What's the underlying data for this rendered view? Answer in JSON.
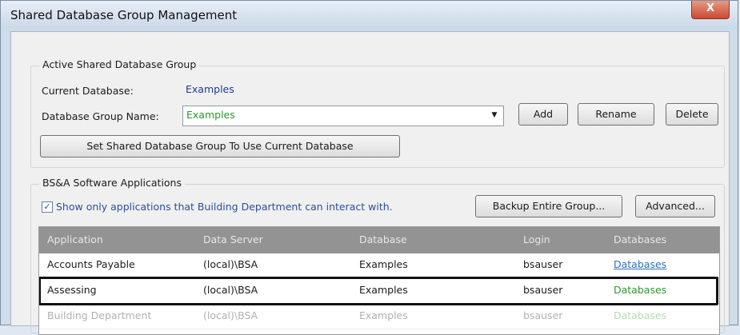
{
  "window": {
    "title": "Shared Database Group Management",
    "close_glyph": "X"
  },
  "active_group": {
    "heading": "Active Shared Database Group",
    "current_database_label": "Current Database:",
    "current_database_value": "Examples",
    "group_name_label": "Database Group Name:",
    "group_name_value": "Examples",
    "add_label": "Add",
    "rename_label": "Rename",
    "delete_label": "Delete",
    "set_shared_label": "Set Shared Database Group To Use Current Database"
  },
  "apps": {
    "heading": "BS&A Software Applications",
    "filter_label": "Show only applications that Building Department can interact with.",
    "filter_checked": true,
    "backup_label": "Backup Entire Group...",
    "advanced_label": "Advanced...",
    "columns": [
      "Application",
      "Data Server",
      "Database",
      "Login",
      "Databases"
    ],
    "rows": [
      [
        "Accounts Payable",
        "(local)\\BSA",
        "Examples",
        "bsauser",
        "Databases"
      ],
      [
        "Assessing",
        "(local)\\BSA",
        "Examples",
        "bsauser",
        "Databases"
      ],
      [
        "Building Department",
        "(local)\\BSA",
        "Examples",
        "bsauser",
        "Databases"
      ]
    ]
  }
}
